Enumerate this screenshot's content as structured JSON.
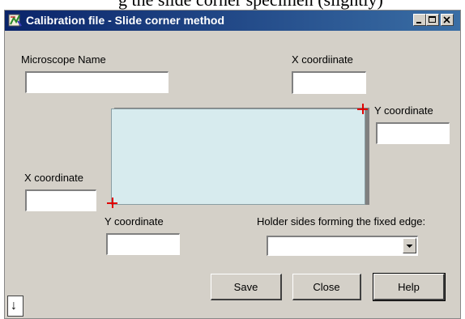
{
  "caption_fragment": "g the slide corner specimen (slightly)",
  "window": {
    "title": "Calibration file - Slide corner method",
    "controls": {
      "minimize": "minimize-icon",
      "maximize": "maximize-icon",
      "close": "close-icon"
    },
    "title_bar_color": "#0a246a",
    "face_color": "#d4d0c8"
  },
  "fields": {
    "microscope_name": {
      "label": "Microscope Name",
      "value": ""
    },
    "top_right_x": {
      "label": "X coordiinate",
      "value": ""
    },
    "top_right_y": {
      "label": "Y coordinate",
      "value": ""
    },
    "bottom_left_x": {
      "label": "X coordinate",
      "value": ""
    },
    "bottom_left_y": {
      "label": "Y coordinate",
      "value": ""
    }
  },
  "holder_sides": {
    "label": "Holder sides forming the fixed edge:",
    "selected": ""
  },
  "slide": {
    "color": "#d7ebee",
    "marker_color": "#e00000"
  },
  "buttons": {
    "save": "Save",
    "close": "Close",
    "help": "Help"
  },
  "arrow_button_symbol": "↓"
}
